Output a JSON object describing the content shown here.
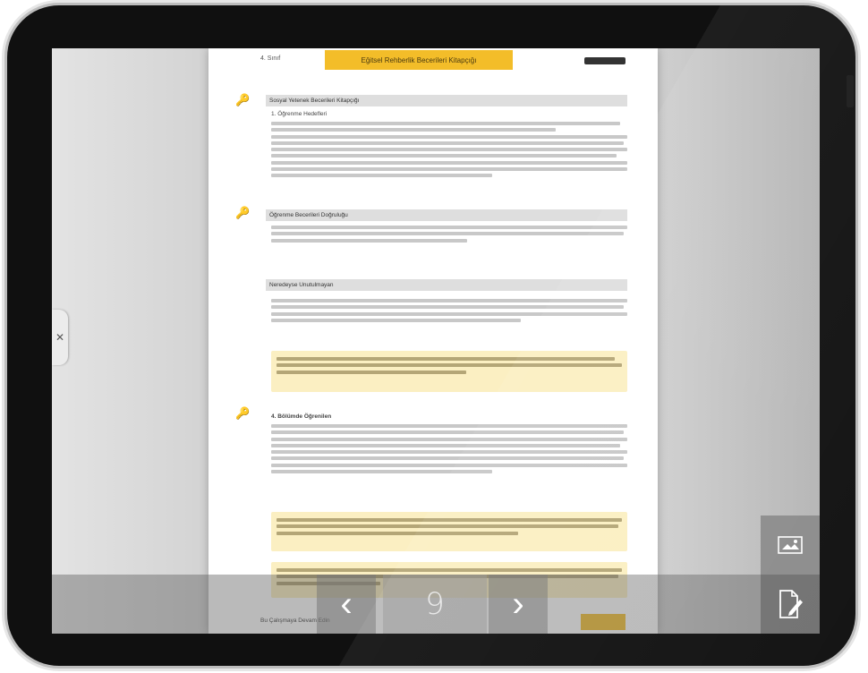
{
  "page": {
    "header": {
      "left_text": "4. Sınıf",
      "title": "Eğitsel Rehberlik Becerileri Kitapçığı"
    },
    "sections": [
      {
        "heading": "Sosyal Yetenek Becerileri Kitapçığı",
        "subheading": "1. Öğrenme Hedefleri"
      },
      {
        "heading": "Öğrenme Becerileri Doğruluğu"
      },
      {
        "heading": "Neredeyse Unutulmayan"
      },
      {
        "heading": "4. Bölümde Öğrenilen"
      }
    ],
    "footer_left": "Bu Çalışmaya Devam Edin"
  },
  "navigation": {
    "prev_glyph": "‹",
    "page_number": "9",
    "next_glyph": "›"
  }
}
